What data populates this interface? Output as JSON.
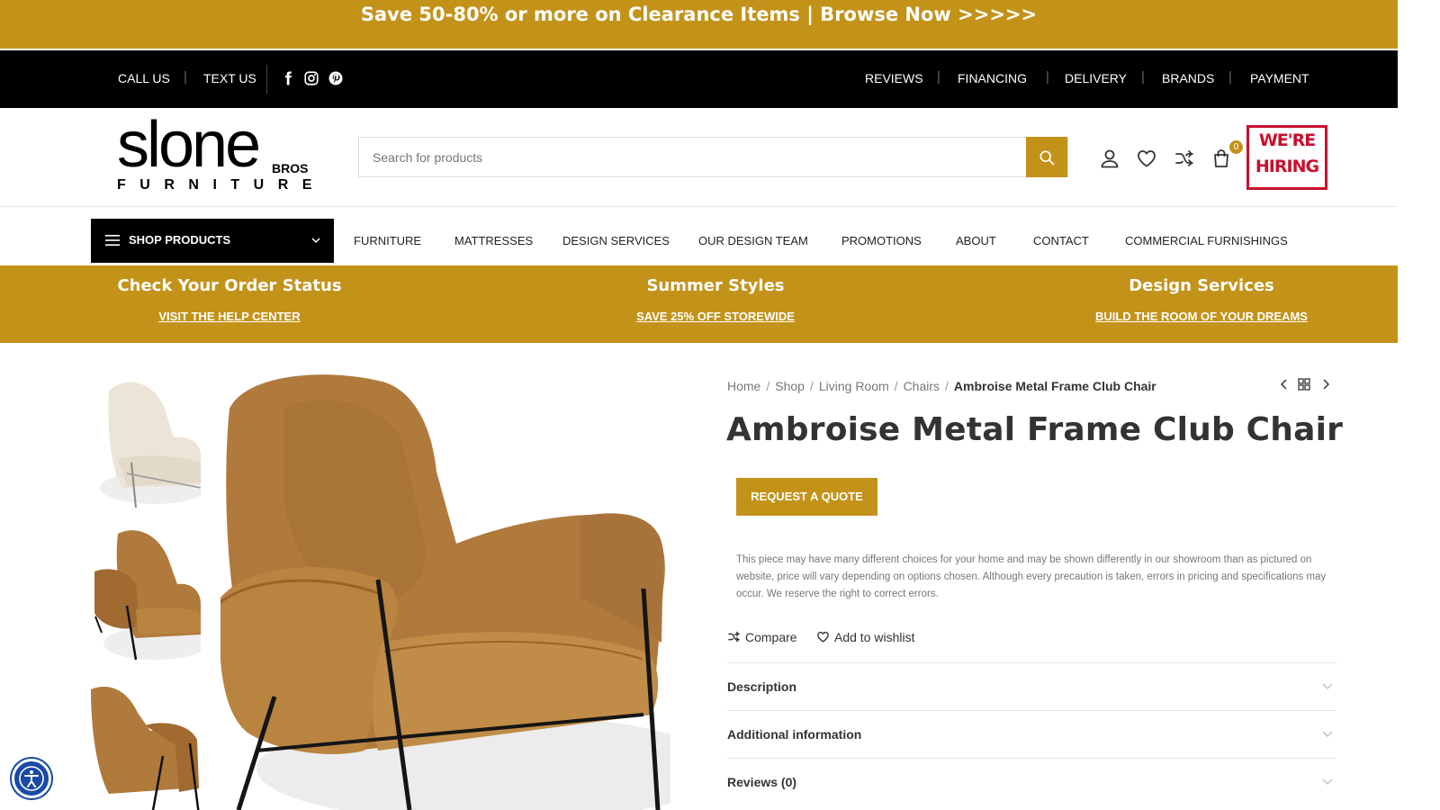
{
  "promo": {
    "text": "Save 50-80% or more on Clearance Items | Browse Now >>>>>"
  },
  "topbar": {
    "call": "CALL US",
    "text": "TEXT US",
    "social_icons": [
      "facebook-icon",
      "instagram-icon",
      "pinterest-icon"
    ],
    "right_links": [
      "REVIEWS",
      "FINANCING",
      "DELIVERY",
      "BRANDS",
      "PAYMENT"
    ],
    "separator": "|"
  },
  "logo": {
    "word": "slone",
    "bros": "BROS",
    "furniture": "FURNITURE"
  },
  "search": {
    "placeholder": "Search for products"
  },
  "header_icons": [
    "user-icon",
    "heart-icon",
    "compare-icon",
    "cart-icon"
  ],
  "cart_count": "0",
  "hiring": {
    "line1": "WE'RE",
    "line2": "HIRING"
  },
  "nav": {
    "shop_label": "SHOP PRODUCTS",
    "items": [
      "FURNITURE",
      "MATTRESSES",
      "DESIGN SERVICES",
      "OUR DESIGN TEAM",
      "PROMOTIONS",
      "ABOUT",
      "CONTACT",
      "COMMERCIAL FURNISHINGS"
    ]
  },
  "info": [
    {
      "title": "Check Your Order Status",
      "link": "VISIT THE HELP CENTER"
    },
    {
      "title": "Summer Styles",
      "link": "SAVE 25% OFF STOREWIDE"
    },
    {
      "title": "Design Services",
      "link": "BUILD THE ROOM OF YOUR DREAMS"
    }
  ],
  "breadcrumb": {
    "items": [
      "Home",
      "Shop",
      "Living Room",
      "Chairs"
    ],
    "current": "Ambroise Metal Frame Club Chair",
    "sep": "/"
  },
  "product": {
    "title": "Ambroise Metal Frame Club Chair",
    "quote_label": "REQUEST A QUOTE",
    "disclaimer": "This piece may have many different choices for your home and may be shown differently in our showroom than as pictured on website, price will vary depending on options chosen. Although every precaution is taken, errors in pricing and specifications may occur. We reserve the right to correct errors.",
    "compare": "Compare",
    "wishlist": "Add to wishlist"
  },
  "accordion": [
    "Description",
    "Additional information",
    "Reviews (0)"
  ],
  "colors": {
    "gold": "#c39219",
    "black": "#000000",
    "hiring_red": "#c8102e",
    "leather": "#b07a3c",
    "a11y_blue": "#1a4aa6"
  }
}
